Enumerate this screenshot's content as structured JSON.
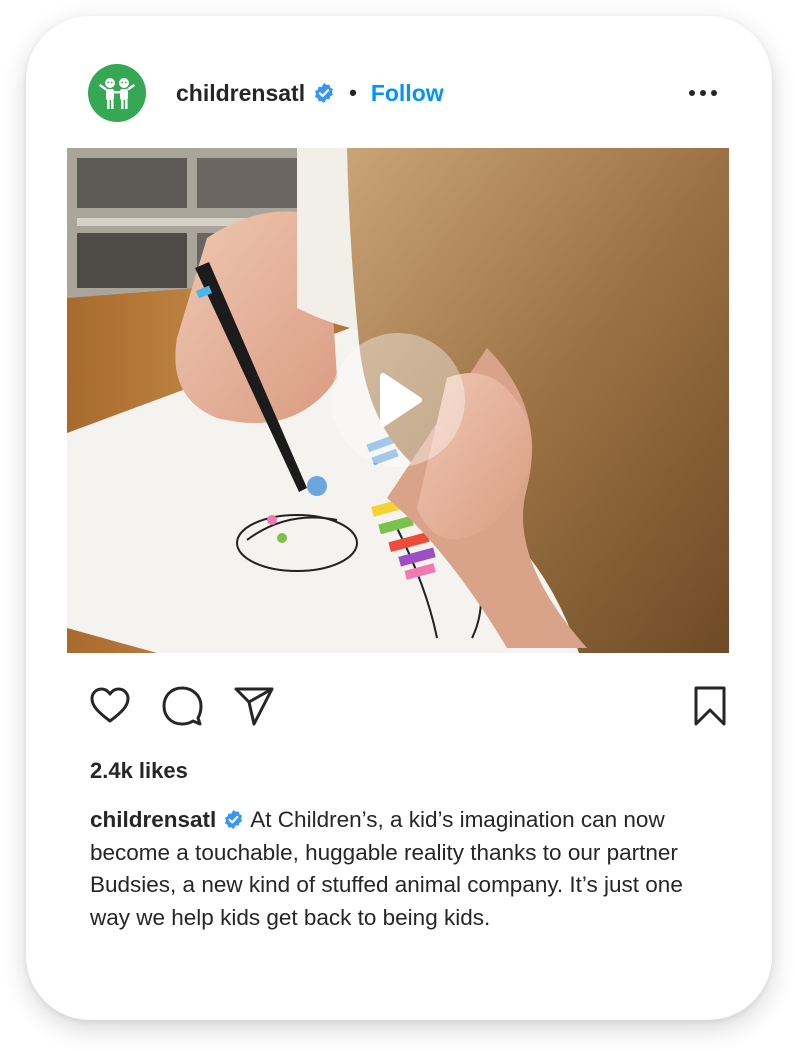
{
  "post": {
    "username": "childrensatl",
    "separator": "•",
    "follow_label": "Follow",
    "more_label": "More options",
    "media": {
      "type": "video",
      "description": "play-icon"
    },
    "likes": "2.4k likes",
    "caption": {
      "username": "childrensatl",
      "text": "At Children’s, a kid’s imagination can now become a touchable, huggable reality thanks to our partner Budsies, a new kind of stuffed animal company. It’s just one way we help kids get back to being kids."
    }
  },
  "colors": {
    "accent": "#0095f6",
    "text": "#262626",
    "avatar_bg": "#34a853",
    "verified": "#3897f0"
  },
  "icons": {
    "like": "heart-icon",
    "comment": "comment-icon",
    "share": "send-icon",
    "save": "bookmark-icon",
    "verified": "verified-badge-icon",
    "more": "more-horizontal-icon"
  }
}
